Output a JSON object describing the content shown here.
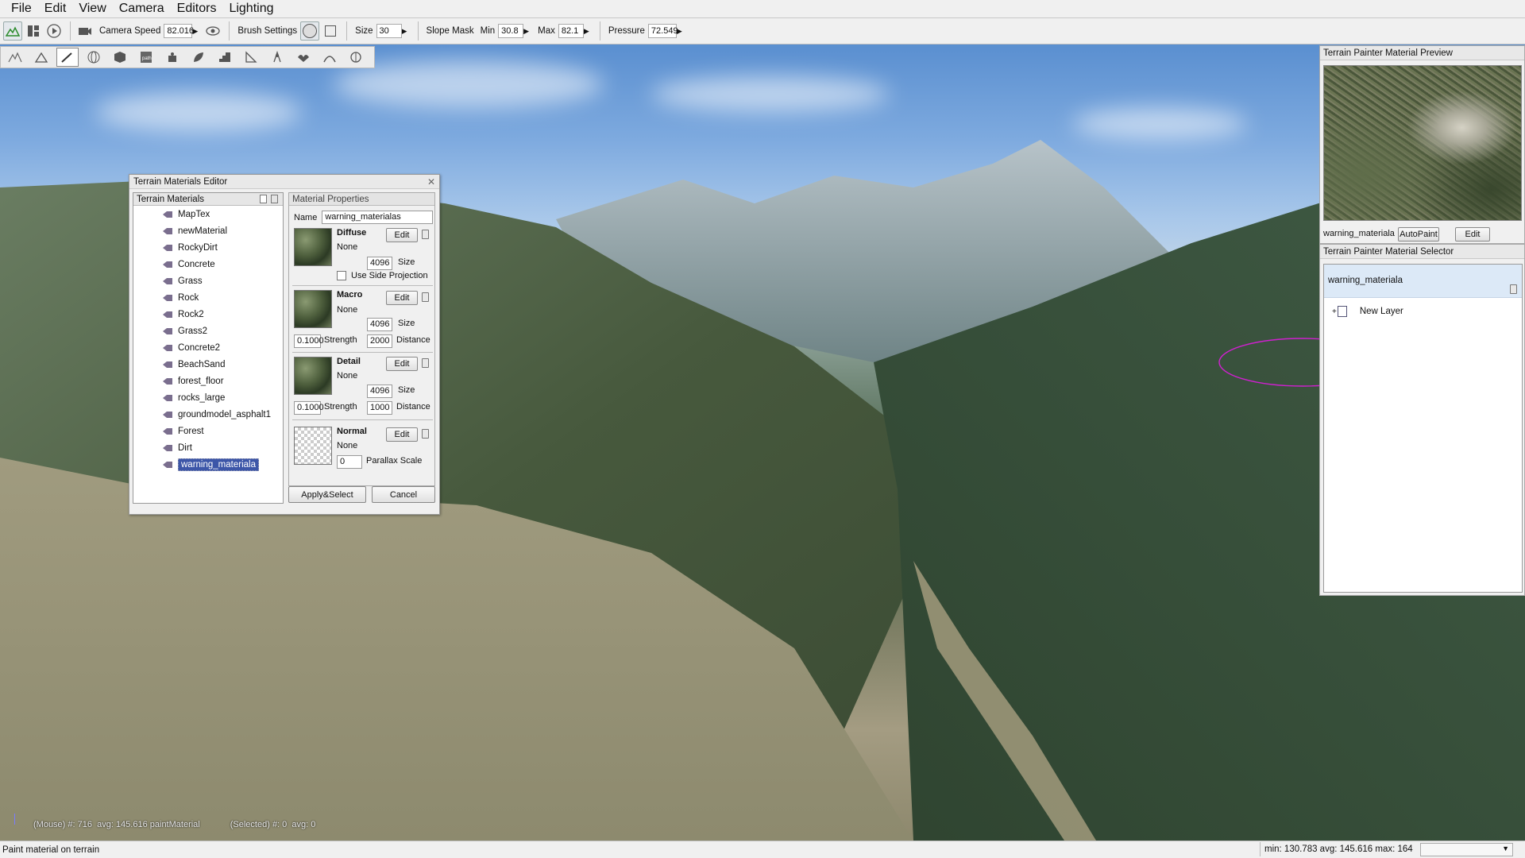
{
  "menubar": {
    "items": [
      "File",
      "Edit",
      "View",
      "Camera",
      "Editors",
      "Lighting"
    ]
  },
  "toolbar": {
    "camera_speed_label": "Camera Speed",
    "camera_speed_value": "82.016",
    "brush_settings_label": "Brush Settings",
    "size_label": "Size",
    "size_value": "30",
    "slope_mask_label": "Slope Mask",
    "min_label": "Min",
    "min_value": "30.8",
    "max_label": "Max",
    "max_value": "82.1",
    "pressure_label": "Pressure",
    "pressure_value": "72.549"
  },
  "palette": {
    "icons": [
      "terrain-up-icon",
      "terrain-tri-icon",
      "paint-brush-icon",
      "globe-icon",
      "cube-icon",
      "path-icon",
      "bucket-icon",
      "leaf-icon",
      "stairs-icon",
      "flag-icon",
      "pin-icon",
      "bird-icon",
      "smooth-icon",
      "lamp-icon"
    ]
  },
  "materials_editor": {
    "title": "Terrain Materials Editor",
    "list_header": "Terrain Materials",
    "materials": [
      "MapTex",
      "newMaterial",
      "RockyDirt",
      "Concrete",
      "Grass",
      "Rock",
      "Rock2",
      "Grass2",
      "Concrete2",
      "BeachSand",
      "forest_floor",
      "rocks_large",
      "groundmodel_asphalt1",
      "Forest",
      "Dirt",
      "warning_materiala"
    ],
    "selected_material": "warning_materiala",
    "properties": {
      "header": "Material Properties",
      "name_label": "Name",
      "name_value": "warning_materialas",
      "edit_label": "Edit",
      "diffuse": {
        "title": "Diffuse",
        "texture": "None",
        "size": "4096",
        "size_label": "Size",
        "side_projection_label": "Use Side Projection"
      },
      "macro": {
        "title": "Macro",
        "texture": "None",
        "size": "4096",
        "size_label": "Size",
        "strength": "0.1000",
        "strength_label": "Strength",
        "distance": "2000",
        "distance_label": "Distance"
      },
      "detail": {
        "title": "Detail",
        "texture": "None",
        "size": "4096",
        "size_label": "Size",
        "strength": "0.1000",
        "strength_label": "Strength",
        "distance": "1000",
        "distance_label": "Distance"
      },
      "normal": {
        "title": "Normal",
        "texture": "None",
        "parallax": "0",
        "parallax_label": "Parallax Scale"
      }
    },
    "apply_label": "Apply&Select",
    "cancel_label": "Cancel"
  },
  "preview_panel": {
    "title": "Terrain Painter Material Preview",
    "material_name": "warning_materiala",
    "autopaint_label": "AutoPaint",
    "edit_label": "Edit"
  },
  "selector_panel": {
    "title": "Terrain Painter Material Selector",
    "selected_material": "warning_materiala",
    "new_layer_label": "New Layer"
  },
  "viewport_info": {
    "mouse": "(Mouse) #: 716  avg: 145.616 paintMaterial",
    "selected": "(Selected) #: 0  avg: 0"
  },
  "statusbar": {
    "message": "Paint material on terrain",
    "stats": "min: 130.783  avg: 145.616  max: 164"
  },
  "colors": {
    "selection_blue": "#3c56a8",
    "brush_outline": "#d020d0"
  }
}
